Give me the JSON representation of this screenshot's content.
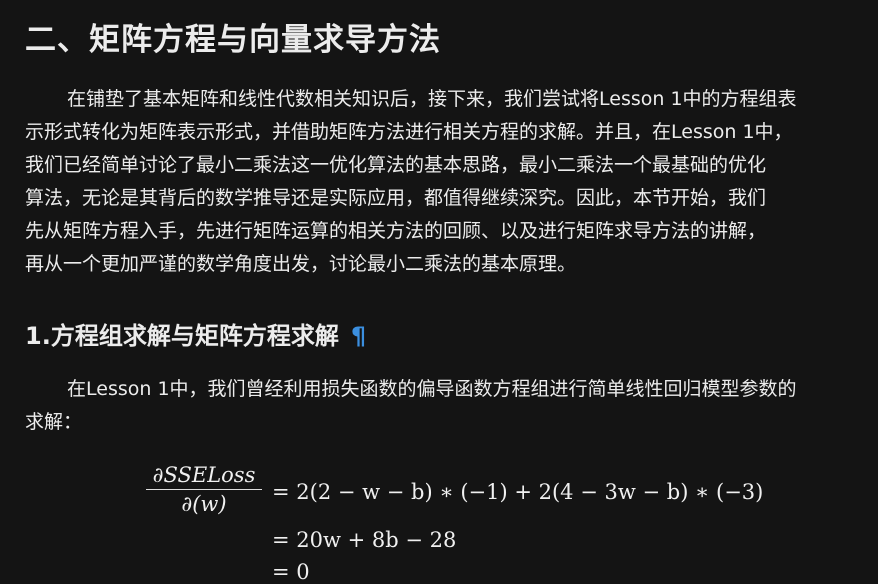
{
  "section_title": "二、矩阵方程与向量求导方法",
  "intro_paragraph": {
    "lines": [
      "在铺垫了基本矩阵和线性代数相关知识后，接下来，我们尝试将Lesson 1中的方程组表",
      "示形式转化为矩阵表示形式，并借助矩阵方法进行相关方程的求解。并且，在Lesson 1中，",
      "我们已经简单讨论了最小二乘法这一优化算法的基本思路，最小二乘法一个最基础的优化",
      "算法，无论是其背后的数学推导还是实际应用，都值得继续深究。因此，本节开始，我们",
      "先从矩阵方程入手，先进行矩阵运算的相关方法的回顾、以及进行矩阵求导方法的讲解，",
      "再从一个更加严谨的数学角度出发，讨论最小二乘法的基本原理。"
    ]
  },
  "subsection": {
    "title": "1.方程组求解与矩阵方程求解",
    "anchor": "¶"
  },
  "paragraph2": {
    "lines": [
      "在Lesson 1中，我们曾经利用损失函数的偏导函数方程组进行简单线性回归模型参数的",
      "求解："
    ]
  },
  "equation": {
    "numerator": "∂SSELoss",
    "denominator": "∂(w)",
    "line1": "= 2(2 − w − b) ∗ (−1) + 2(4 − 3w − b) ∗ (−3)",
    "line2": "= 20w + 8b − 28",
    "line3": "= 0"
  },
  "colors": {
    "background": "#141414",
    "text": "#ececec",
    "anchor": "#3b8fe0"
  }
}
